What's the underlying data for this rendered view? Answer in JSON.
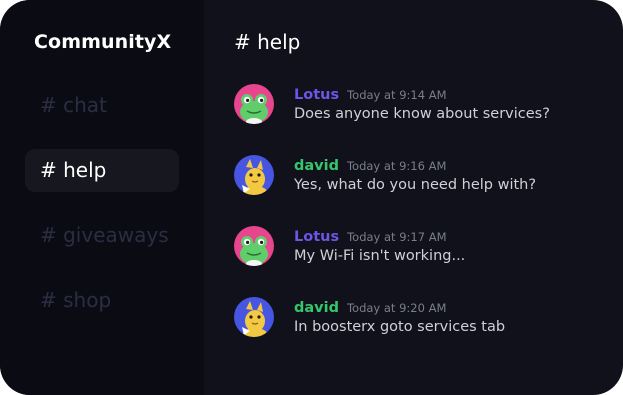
{
  "server": {
    "name": "CommunityX"
  },
  "sidebar": {
    "channels": [
      {
        "label": "# chat",
        "active": false
      },
      {
        "label": "# help",
        "active": true
      },
      {
        "label": "# giveaways",
        "active": false
      },
      {
        "label": "# shop",
        "active": false
      }
    ]
  },
  "main": {
    "channel_title": "# help",
    "messages": [
      {
        "author": "Lotus",
        "time": "Today at 9:14 AM",
        "text": "Does anyone know about services?",
        "avatar": "frog-avatar-icon"
      },
      {
        "author": "david",
        "time": "Today at 9:16 AM",
        "text": "Yes, what do you need help with?",
        "avatar": "cat-avatar-icon"
      },
      {
        "author": "Lotus",
        "time": "Today at 9:17 AM",
        "text": "My Wi-Fi isn't working...",
        "avatar": "frog-avatar-icon"
      },
      {
        "author": "david",
        "time": "Today at 9:20 AM",
        "text": "In boosterx goto services tab",
        "avatar": "cat-avatar-icon"
      }
    ]
  },
  "colors": {
    "app_background": "#10111a",
    "sidebar_background": "#0b0c13",
    "active_channel_background": "#17181f",
    "inactive_channel_text": "#2b2e42",
    "lotus_name": "#6a57e6",
    "david_name": "#36c56a",
    "frog_avatar_background": "#e8458f",
    "cat_avatar_background": "#4656e0"
  }
}
